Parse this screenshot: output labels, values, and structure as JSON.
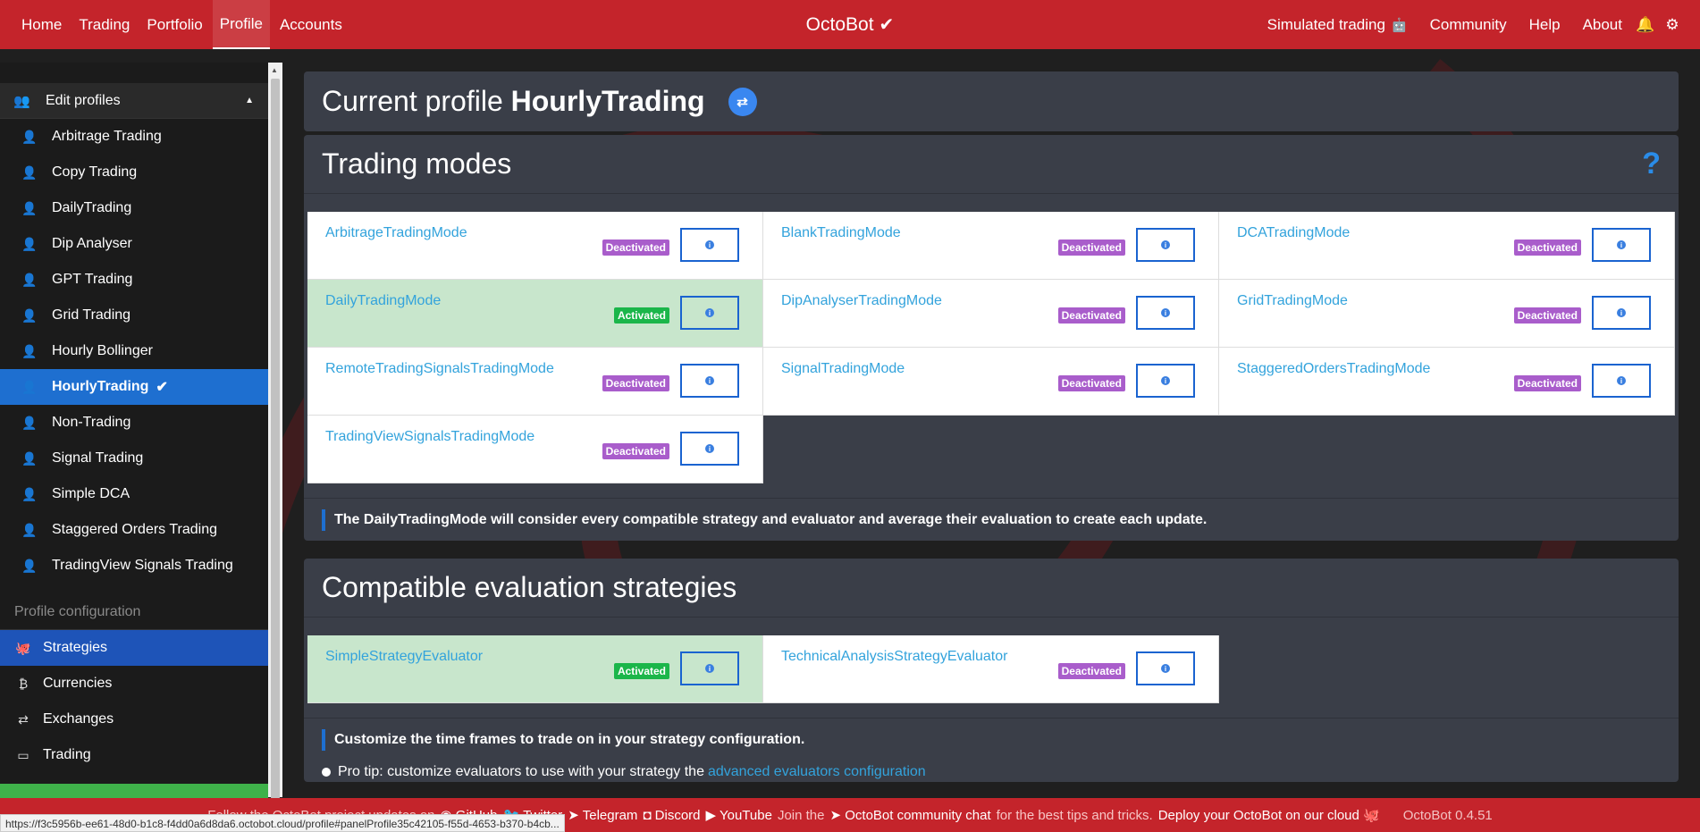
{
  "topnav": {
    "left_items": [
      "Home",
      "Trading",
      "Portfolio",
      "Profile",
      "Accounts"
    ],
    "active": "Profile",
    "brand": "OctoBot",
    "right_items": [
      "Simulated trading",
      "Community",
      "Help",
      "About"
    ]
  },
  "sidebar": {
    "edit_profiles_label": "Edit profiles",
    "profiles": [
      {
        "label": "Arbitrage Trading",
        "icon": "user-lock-icon"
      },
      {
        "label": "Copy Trading",
        "icon": "user-lock-icon"
      },
      {
        "label": "DailyTrading",
        "icon": "user-lock-icon"
      },
      {
        "label": "Dip Analyser",
        "icon": "user-lock-icon"
      },
      {
        "label": "GPT Trading",
        "icon": "user-lock-icon"
      },
      {
        "label": "Grid Trading",
        "icon": "user-lock-icon"
      },
      {
        "label": "Hourly Bollinger",
        "icon": "user-icon"
      },
      {
        "label": "HourlyTrading",
        "icon": "user-icon",
        "active": true
      },
      {
        "label": "Non-Trading",
        "icon": "user-lock-icon"
      },
      {
        "label": "Signal Trading",
        "icon": "user-lock-icon"
      },
      {
        "label": "Simple DCA",
        "icon": "user-lock-icon"
      },
      {
        "label": "Staggered Orders Trading",
        "icon": "user-lock-icon"
      },
      {
        "label": "TradingView Signals Trading",
        "icon": "user-lock-icon"
      }
    ],
    "config_header": "Profile configuration",
    "config_items": [
      "Strategies",
      "Currencies",
      "Exchanges",
      "Trading"
    ]
  },
  "main": {
    "current_profile_prefix": "Current profile",
    "current_profile_name": "HourlyTrading",
    "trading_modes_title": "Trading modes",
    "trading_modes": [
      {
        "name": "ArbitrageTradingMode",
        "status": "Deactivated"
      },
      {
        "name": "BlankTradingMode",
        "status": "Deactivated"
      },
      {
        "name": "DCATradingMode",
        "status": "Deactivated"
      },
      {
        "name": "DailyTradingMode",
        "status": "Activated"
      },
      {
        "name": "DipAnalyserTradingMode",
        "status": "Deactivated"
      },
      {
        "name": "GridTradingMode",
        "status": "Deactivated"
      },
      {
        "name": "RemoteTradingSignalsTradingMode",
        "status": "Deactivated"
      },
      {
        "name": "SignalTradingMode",
        "status": "Deactivated"
      },
      {
        "name": "StaggeredOrdersTradingMode",
        "status": "Deactivated"
      },
      {
        "name": "TradingViewSignalsTradingMode",
        "status": "Deactivated"
      }
    ],
    "trading_mode_note": "The DailyTradingMode will consider every compatible strategy and evaluator and average their evaluation to create each update.",
    "strategies_title": "Compatible evaluation strategies",
    "strategies": [
      {
        "name": "SimpleStrategyEvaluator",
        "status": "Activated"
      },
      {
        "name": "TechnicalAnalysisStrategyEvaluator",
        "status": "Deactivated"
      }
    ],
    "strategies_note": "Customize the time frames to trade on in your strategy configuration.",
    "tip_text": "Pro tip: customize evaluators to use with your strategy the",
    "tip_link": "advanced evaluators configuration"
  },
  "footer": {
    "prefix": "Follow the OctoBot project updates on",
    "links": [
      "GitHub",
      "Twitter",
      "Telegram",
      "Discord",
      "YouTube"
    ],
    "join_prefix": "Join the",
    "community_link": "OctoBot community chat",
    "join_suffix": "for the best tips and tricks.",
    "cloud_text": "Deploy your OctoBot on our cloud",
    "version": "OctoBot 0.4.51"
  },
  "status_url": "https://f3c5956b-ee61-48d0-b1c8-f4dd0a6d8da6.octobot.cloud/profile#panelProfile35c42105-f55d-4653-b370-b4cb...",
  "colors": {
    "nav_red": "#c4242b",
    "active_blue": "#1e6fd0",
    "deactivated_purple": "#a95dcb",
    "activated_green": "#1bb64a",
    "link_blue": "#33a3dc"
  }
}
